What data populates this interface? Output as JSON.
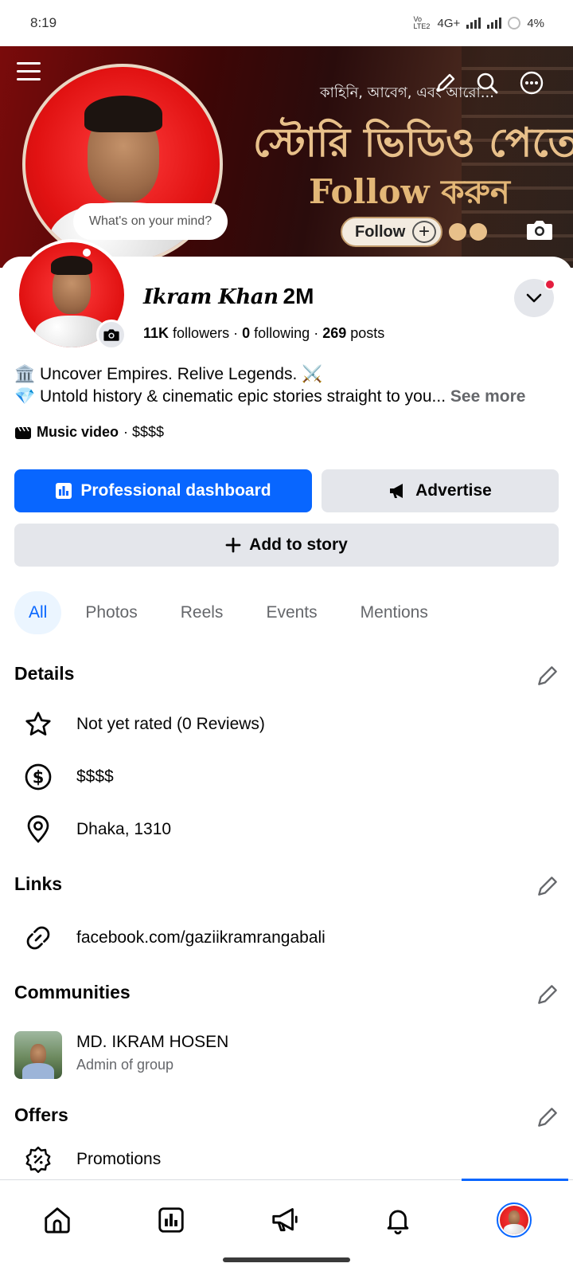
{
  "status_bar": {
    "time": "8:19",
    "network": "4G+",
    "lte_label": "Vo LTE2",
    "battery": "4%"
  },
  "cover": {
    "tagline": "কাহিনি, আবেগ, এবং আরো...",
    "headline": "স্টোরি ভিডিও পেতে",
    "follow_text": "Follow করুন",
    "follow_button": "Follow",
    "whats_on_mind": "What's on your mind?"
  },
  "profile": {
    "name": "Ikram Khan",
    "followers_badge": "2M",
    "followers_count": "11K",
    "followers_label": "followers",
    "following_count": "0",
    "following_label": "following",
    "posts_count": "269",
    "posts_label": "posts",
    "bio_line1": "🏛️ Uncover Empires. Relive Legends. ⚔️",
    "bio_line2": "💎 Untold history & cinematic epic stories straight to you...",
    "see_more": "See more",
    "category": "Music video",
    "category_price": "· $$$$"
  },
  "actions": {
    "professional_dashboard": "Professional dashboard",
    "advertise": "Advertise",
    "add_to_story": "Add to story"
  },
  "tabs": [
    "All",
    "Photos",
    "Reels",
    "Events",
    "Mentions"
  ],
  "details": {
    "title": "Details",
    "rating": "Not yet rated (0 Reviews)",
    "price": "$$$$",
    "location": "Dhaka, 1310"
  },
  "links": {
    "title": "Links",
    "url": "facebook.com/gaziikramrangabali"
  },
  "communities": {
    "title": "Communities",
    "name": "MD. IKRAM HOSEN",
    "role": "Admin of group"
  },
  "offers": {
    "title": "Offers",
    "promotions": "Promotions"
  },
  "colors": {
    "primary": "#0866ff",
    "grey_button": "#e4e6eb",
    "secondary_text": "#65676b",
    "notification": "#e41e3f"
  },
  "bottom_nav": [
    "home-icon",
    "dashboard-icon",
    "megaphone-icon",
    "bell-icon",
    "profile-avatar"
  ]
}
